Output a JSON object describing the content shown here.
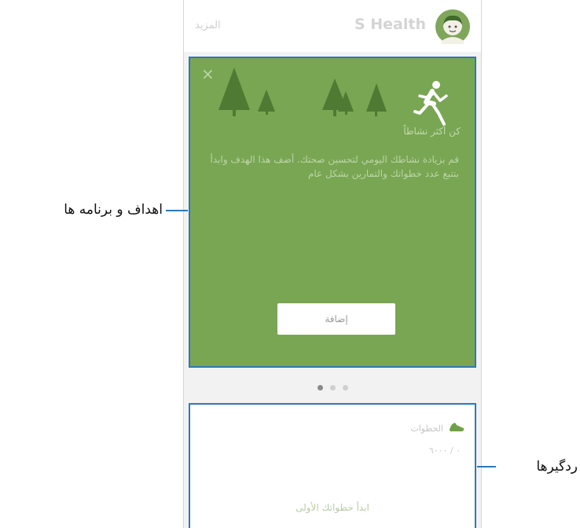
{
  "app": {
    "title": "S Health",
    "more_link": "المزيد"
  },
  "program_card": {
    "close_symbol": "×",
    "heading": "كن أكثر نشاطاً",
    "body": "قم بزيادة نشاطك اليومي لتحسين صحتك. أضف هذا الهدف وابدأ بتتبع عدد خطواتك والتمارين بشكل عام",
    "add_button": "إضافة",
    "background": "#79a653"
  },
  "pager": {
    "pages": 3,
    "active": 0
  },
  "tracker_card": {
    "title": "الخطوات",
    "value": "٠ / ٦٠٠٠",
    "start_text": "ابدأ خطواتك الأولى"
  },
  "callouts": {
    "goals": "اهداف و برنامه ها",
    "trackers": "ردگیرها"
  },
  "colors": {
    "highlight": "#2e78b8",
    "card_green": "#79a653",
    "tree_green": "#4e7a33"
  },
  "icons": [
    "close-icon",
    "tree-icon",
    "runner-icon",
    "avatar-icon",
    "shoe-icon"
  ]
}
